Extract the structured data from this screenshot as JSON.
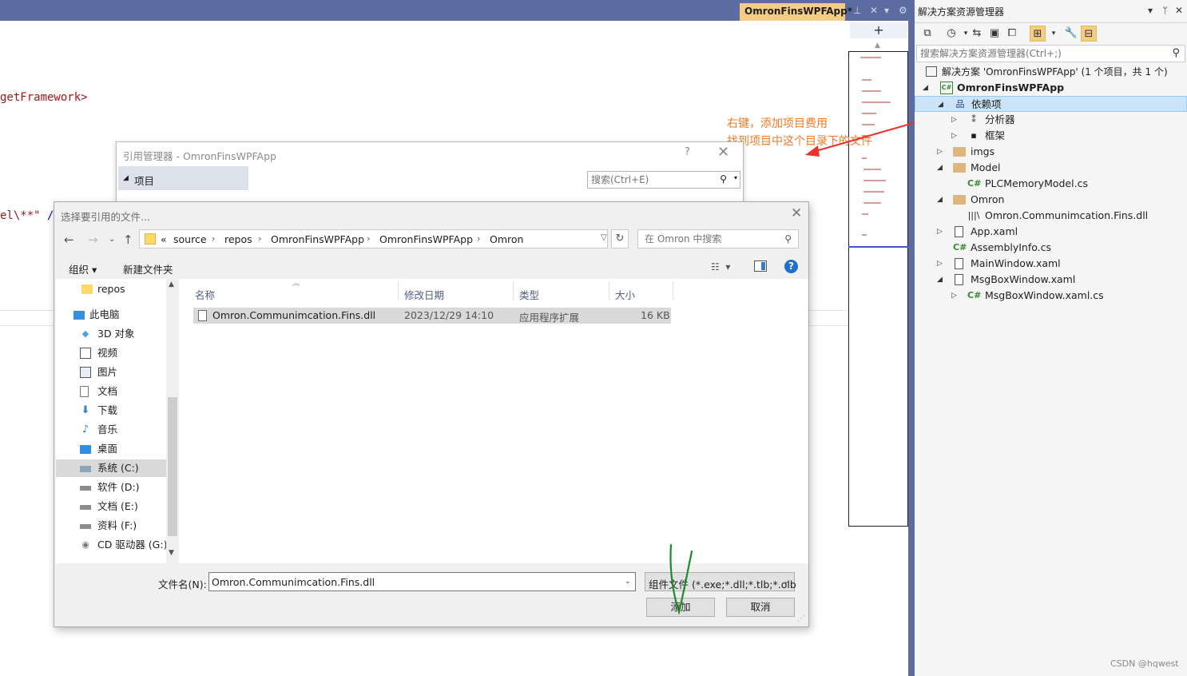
{
  "editor": {
    "code_line1": "getFramework>",
    "code_line2_red": "el\\**\"",
    "code_line2_blue": " />"
  },
  "doc_tab": {
    "title": "OmronFinsWPFApp*",
    "pin_icon": "pin-icon",
    "close": "✕"
  },
  "annotation": {
    "line1": "右键，添加项目费用",
    "line2": "找到项目中这个目录下的文件"
  },
  "solution_explorer": {
    "title": "解决方案资源管理器",
    "search_placeholder": "搜索解决方案资源管理器(Ctrl+;)",
    "tree": [
      {
        "label": "解决方案 'OmronFinsWPFApp' (1 个项目，共 1 个)",
        "icon": "solution-icon"
      },
      {
        "label": "OmronFinsWPFApp",
        "icon": "csharp-project-icon"
      },
      {
        "label": "依赖项",
        "icon": "dependencies-icon"
      },
      {
        "label": "分析器",
        "icon": "analyzer-icon"
      },
      {
        "label": "框架",
        "icon": "framework-icon"
      },
      {
        "label": "imgs",
        "icon": "folder-icon"
      },
      {
        "label": "Model",
        "icon": "folder-icon"
      },
      {
        "label": "PLCMemoryModel.cs",
        "icon": "csharp-file-icon"
      },
      {
        "label": "Omron",
        "icon": "folder-icon"
      },
      {
        "label": "Omron.Communimcation.Fins.dll",
        "icon": "reference-icon"
      },
      {
        "label": "App.xaml",
        "icon": "xaml-file-icon"
      },
      {
        "label": "AssemblyInfo.cs",
        "icon": "csharp-file-icon"
      },
      {
        "label": "MainWindow.xaml",
        "icon": "xaml-file-icon"
      },
      {
        "label": "MsgBoxWindow.xaml",
        "icon": "xaml-file-icon"
      },
      {
        "label": "MsgBoxWindow.xaml.cs",
        "icon": "csharp-file-icon"
      }
    ]
  },
  "ref_manager": {
    "title": "引用管理器 - OmronFinsWPFApp",
    "help": "?",
    "side_item": "项目",
    "search_placeholder": "搜索(Ctrl+E)"
  },
  "file_dialog": {
    "title": "选择要引用的文件...",
    "breadcrumb": [
      "«",
      "source",
      "repos",
      "OmronFinsWPFApp",
      "OmronFinsWPFApp",
      "Omron"
    ],
    "search_placeholder": "在 Omron 中搜索",
    "organize": "组织 ▾",
    "new_folder": "新建文件夹",
    "nav": [
      {
        "label": "repos",
        "icon": "folder-icon"
      },
      {
        "label": "此电脑",
        "icon": "computer-icon"
      },
      {
        "label": "3D 对象",
        "icon": "3d-objects-icon"
      },
      {
        "label": "视频",
        "icon": "video-icon"
      },
      {
        "label": "图片",
        "icon": "pictures-icon"
      },
      {
        "label": "文档",
        "icon": "documents-icon"
      },
      {
        "label": "下载",
        "icon": "download-icon"
      },
      {
        "label": "音乐",
        "icon": "music-icon"
      },
      {
        "label": "桌面",
        "icon": "desktop-icon"
      },
      {
        "label": "系统 (C:)",
        "icon": "drive-icon"
      },
      {
        "label": "软件 (D:)",
        "icon": "drive-icon"
      },
      {
        "label": "文档 (E:)",
        "icon": "drive-icon"
      },
      {
        "label": "资料 (F:)",
        "icon": "drive-icon"
      },
      {
        "label": "CD 驱动器 (G:)",
        "icon": "cd-drive-icon"
      }
    ],
    "columns": [
      "名称",
      "修改日期",
      "类型",
      "大小"
    ],
    "files": [
      {
        "name": "Omron.Communimcation.Fins.dll",
        "date": "2023/12/29 14:10",
        "type": "应用程序扩展",
        "size": "16 KB"
      }
    ],
    "filename_label": "文件名(N):",
    "filename_value": "Omron.Communimcation.Fins.dll",
    "filetype": "组件文件 (*.exe;*.dll;*.tlb;*.olb",
    "add_button": "添加",
    "cancel_button": "取消"
  },
  "watermark": "CSDN @hqwest",
  "colors": {
    "vs_frame": "#5c6ba0",
    "active_tab": "#f5cc84",
    "annotation": "#f47a24",
    "selection": "#cce4f7"
  }
}
